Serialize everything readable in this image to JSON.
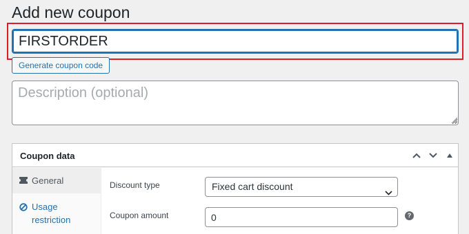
{
  "page": {
    "title": "Add new coupon"
  },
  "coupon": {
    "code_value": "FIRSTORDER",
    "generate_label": "Generate coupon code",
    "description_placeholder": "Description (optional)"
  },
  "coupon_data": {
    "title": "Coupon data",
    "controls": [
      "chevron-up-icon",
      "chevron-down-icon",
      "triangle-up-icon"
    ],
    "tabs": [
      {
        "label": "General",
        "icon": "ticket-icon",
        "active": true
      },
      {
        "label": "Usage restriction",
        "icon": "prohibited-icon",
        "active": false
      }
    ],
    "fields": {
      "discount_type_label": "Discount type",
      "discount_type_value": "Fixed cart discount",
      "amount_label": "Coupon amount",
      "amount_value": "0",
      "help_glyph": "?"
    }
  },
  "colors": {
    "accent": "#2271b1",
    "highlight": "#e01b24",
    "background": "#f0f0f1"
  }
}
